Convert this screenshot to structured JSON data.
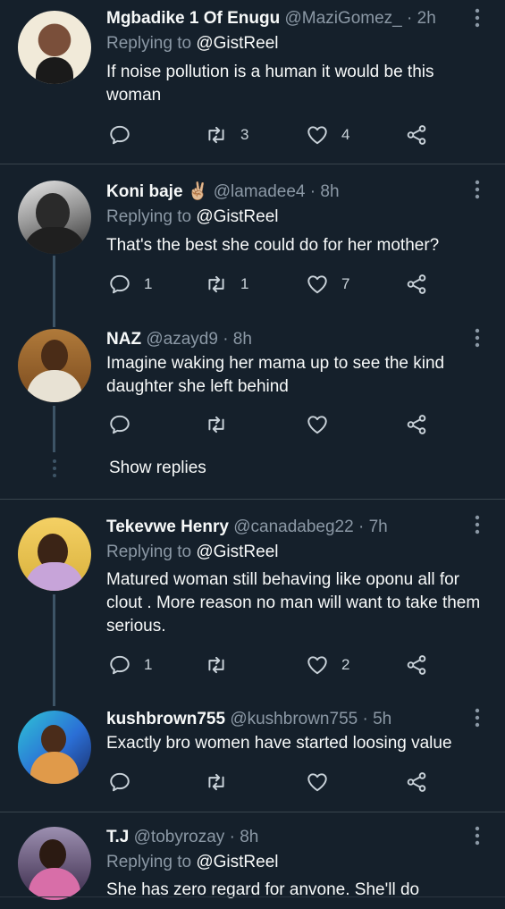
{
  "reply_label": "Replying to",
  "tweets": [
    {
      "name": "Mgbadike 1 Of Enugu",
      "handle": "@MaziGomez_",
      "dot": "·",
      "time": "2h",
      "reply_to": "@GistReel",
      "text": "If noise pollution is a human it would be this woman",
      "replies": "",
      "retweets": "3",
      "likes": "4"
    },
    {
      "name": "Koni baje ✌🏼",
      "handle": "@lamadee4",
      "dot": "·",
      "time": "8h",
      "reply_to": "@GistReel",
      "text": "That's the best she could do for her mother?",
      "replies": "1",
      "retweets": "1",
      "likes": "7"
    },
    {
      "name": "NAZ",
      "handle": "@azayd9",
      "dot": "·",
      "time": "8h",
      "text": "Imagine waking her mama up to see the kind daughter she left behind",
      "replies": "",
      "retweets": "",
      "likes": ""
    },
    {
      "name": "Tekevwe Henry",
      "handle": "@canadabeg22",
      "dot": "·",
      "time": "7h",
      "reply_to": "@GistReel",
      "text": "Matured woman still behaving like oponu all for clout . More reason no man will want to take them serious.",
      "replies": "1",
      "retweets": "",
      "likes": "2"
    },
    {
      "name": "kushbrown755",
      "handle": "@kushbrown755",
      "dot": "·",
      "time": "5h",
      "text": "Exactly bro women have started loosing value",
      "replies": "",
      "retweets": "",
      "likes": ""
    },
    {
      "name": "T.J",
      "handle": "@tobyrozay",
      "dot": "·",
      "time": "8h",
      "reply_to": "@GistReel",
      "text": "She has zero regard for anvone. She'll do"
    }
  ],
  "show_replies": "Show replies",
  "icons": [
    "reply-icon",
    "retweet-icon",
    "like-icon",
    "share-icon",
    "more-icon"
  ],
  "colors": {
    "background": "#15202b",
    "secondary_text": "#8b98a5",
    "thread_line": "#3d5466"
  }
}
